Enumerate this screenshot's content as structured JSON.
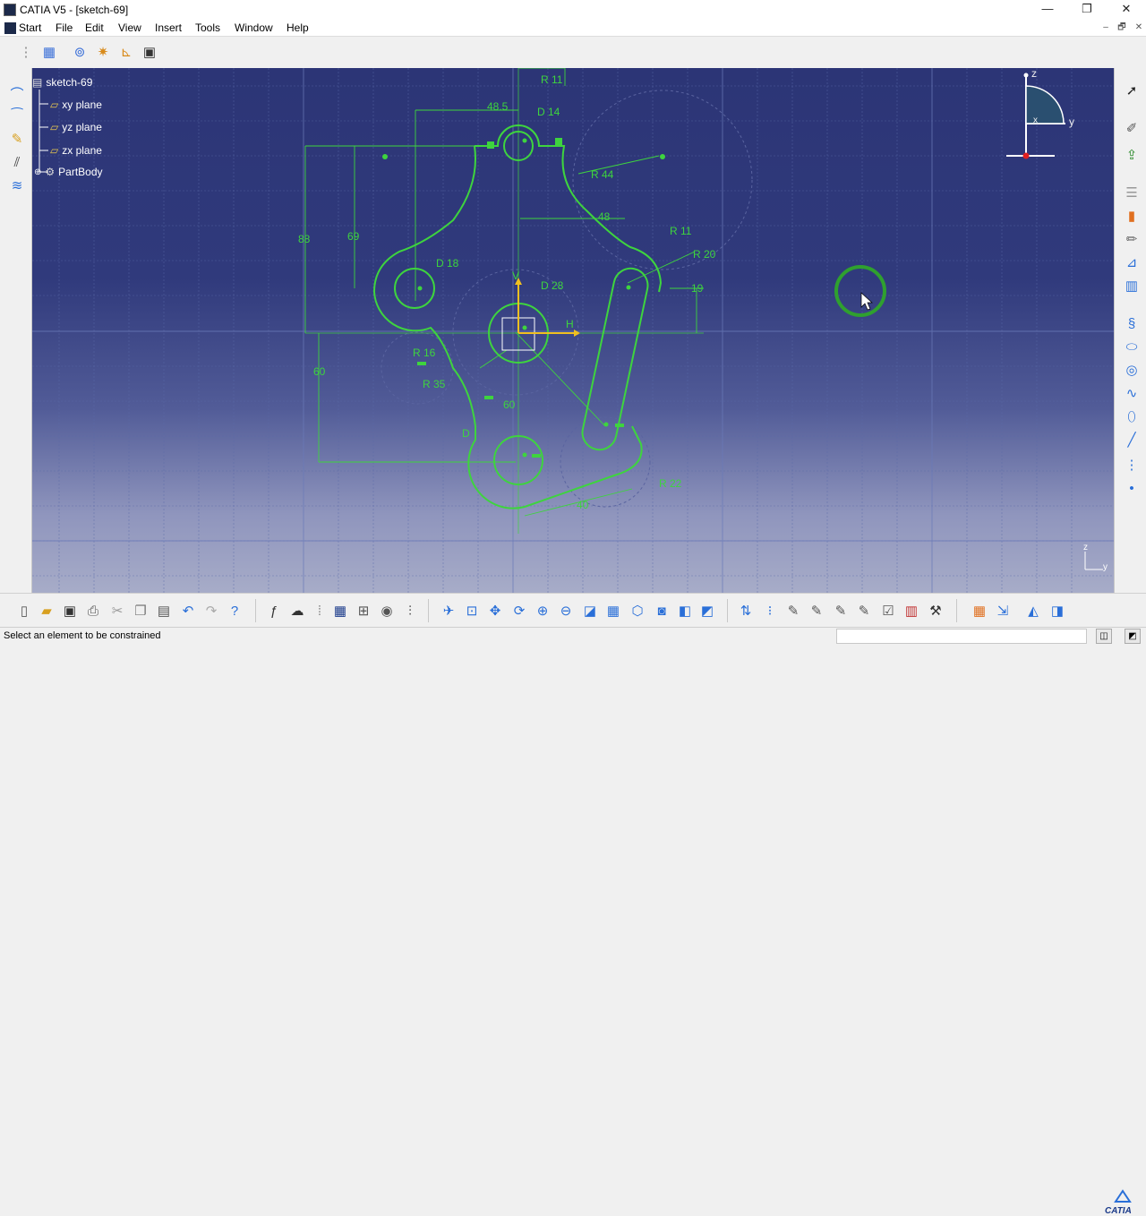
{
  "window": {
    "title": "CATIA V5 - [sketch-69]",
    "controls": [
      "—",
      "❐",
      "✕"
    ]
  },
  "menu": {
    "items": [
      "Start",
      "File",
      "Edit",
      "View",
      "Insert",
      "Tools",
      "Window",
      "Help"
    ],
    "mdi_controls": [
      "–",
      "🗗",
      "✕"
    ]
  },
  "tree": {
    "root": "sketch-69",
    "children": [
      "xy plane",
      "yz plane",
      "zx plane",
      "PartBody"
    ]
  },
  "compass": {
    "axis_z": "z",
    "axis_x": "x",
    "axis_y": "y"
  },
  "axis_corner": {
    "z": "z",
    "y": "y"
  },
  "sketch": {
    "h_axis_label": "H",
    "v_axis_label": "V",
    "dimensions": [
      "R 11",
      "48.5",
      "D 14",
      "R 44",
      "48",
      "R 11",
      "R 20",
      "88",
      "69",
      "D 18",
      "D 28",
      "19",
      "R 16",
      "R 35",
      "60",
      "60",
      "D",
      "R 22",
      "40"
    ]
  },
  "status": {
    "message": "Select an element to be constrained"
  },
  "brand": {
    "logo_text": "CATIA"
  },
  "colors": {
    "sketch_green": "#3ed43e",
    "viewport_top": "#2c3576",
    "viewport_bottom": "#a7acc8",
    "constraint_marker": "#1f6f1f"
  }
}
